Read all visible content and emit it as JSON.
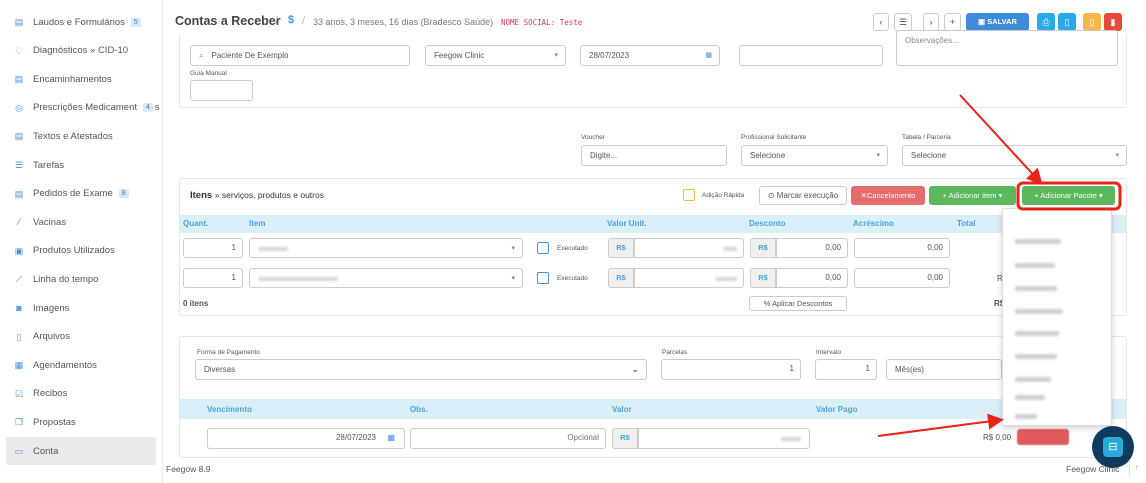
{
  "sidebar": {
    "items": [
      {
        "label": "Laudos e Formulários",
        "icon": "document-icon",
        "badge": "5"
      },
      {
        "label": "Diagnósticos » CID-10",
        "icon": "stethoscope-icon",
        "badge": ""
      },
      {
        "label": "Encaminhamentos",
        "icon": "document-icon",
        "badge": ""
      },
      {
        "label": "Prescrições Medicament",
        "icon": "pills-icon",
        "badge": "4",
        "suffix": "s"
      },
      {
        "label": "Textos e Atestados",
        "icon": "document-icon",
        "badge": ""
      },
      {
        "label": "Tarefas",
        "icon": "list-icon",
        "badge": ""
      },
      {
        "label": "Pedidos de Exame",
        "icon": "document-icon",
        "badge": "8"
      },
      {
        "label": "Vacinas",
        "icon": "syringe-icon",
        "badge": ""
      },
      {
        "label": "Produtos Utilizados",
        "icon": "box-icon",
        "badge": ""
      },
      {
        "label": "Linha do tempo",
        "icon": "line-chart-icon",
        "badge": ""
      },
      {
        "label": "Imagens",
        "icon": "camera-icon",
        "badge": ""
      },
      {
        "label": "Arquivos",
        "icon": "file-icon",
        "badge": ""
      },
      {
        "label": "Agendamentos",
        "icon": "calendar-icon",
        "badge": ""
      },
      {
        "label": "Recibos",
        "icon": "receipt-icon",
        "badge": ""
      },
      {
        "label": "Propostas",
        "icon": "copy-icon",
        "badge": ""
      },
      {
        "label": "Conta",
        "icon": "money-icon",
        "badge": "",
        "active": true
      }
    ],
    "version": "Feegow 8.9"
  },
  "header": {
    "title": "Contas a Receber",
    "separator": "/",
    "dollar": "$",
    "patient_info": "33 anos, 3 meses, 16 dias (Bradesco Saúde)",
    "social_name": "NOME SOCIAL: Teste",
    "save_label": "SALVAR",
    "nav_prev": "‹",
    "nav_list": "☰",
    "nav_next": "›",
    "nav_add": "+"
  },
  "form": {
    "patient": "Paciente De Exemplo",
    "unit": "Feegow Clinic",
    "date": "28/07/2023",
    "notes_placeholder": "Observações...",
    "guia_label": "Guia Manual",
    "voucher_label": "Voucher",
    "voucher_placeholder": "Digite...",
    "prof_label": "Profissional Solicitante",
    "prof_value": "Selecione",
    "table_label": "Tabela / Parceria",
    "table_value": "Selecione"
  },
  "items": {
    "title": "Itens",
    "subtitle": "» serviços, produtos e outros",
    "quick_add": "Adição Rápida",
    "mark_exec": "Marcar execução",
    "cancel": "Cancelamento",
    "add_item": "+ Adicionar Item",
    "add_package": "+ Adicionar Pacote",
    "columns": [
      "Quant.",
      "Item",
      "Valor Unit.",
      "Desconto",
      "Acréscimo",
      "Total"
    ],
    "rows": [
      {
        "qty": "1",
        "executed": "Executado",
        "currency": "R$",
        "discount": "0,00",
        "increase": "0,00"
      },
      {
        "qty": "1",
        "executed": "Executado",
        "currency": "R$",
        "discount": "0,00",
        "increase": "0,00"
      }
    ],
    "count": "0 itens",
    "apply_discounts": "Aplicar Descontos",
    "total_prefix": "R$"
  },
  "payment": {
    "method_label": "Forma de Pagamento",
    "method_value": "Diversas",
    "installments_label": "Parcelas",
    "installments_value": "1",
    "interval_label": "Intervalo",
    "interval_value": "1",
    "interval_unit": "Mês(es)",
    "columns": [
      "Vencimento",
      "Obs.",
      "Valor",
      "Valor Pago"
    ],
    "due_date": "28/07/2023",
    "obs_placeholder": "Opcional",
    "currency": "R$",
    "paid": "R$ 0,00"
  },
  "footer": {
    "brand": "Feegow Clinic"
  },
  "colors": {
    "primary": "#3d8bda",
    "success": "#5cb85c",
    "danger": "#e76d6d",
    "annotation": "#e8231a",
    "header_bg": "#dbeff9"
  }
}
